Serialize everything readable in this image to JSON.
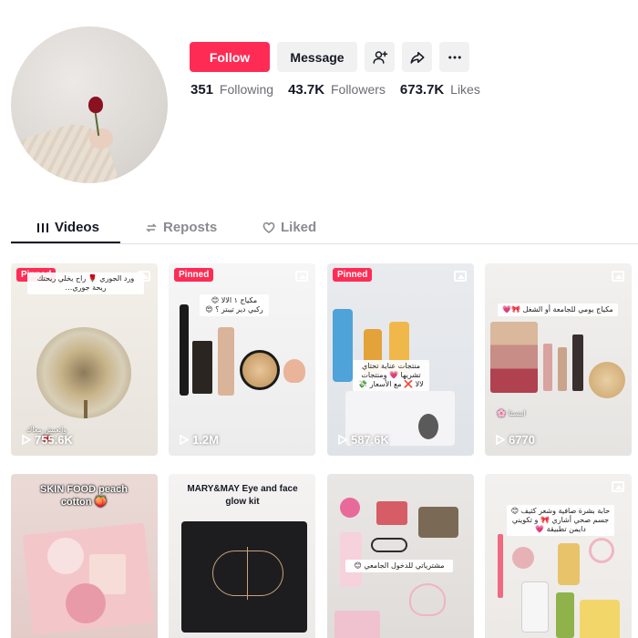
{
  "profile": {
    "follow_label": "Follow",
    "message_label": "Message",
    "stats": {
      "following_count": "351",
      "following_label": "Following",
      "followers_count": "43.7K",
      "followers_label": "Followers",
      "likes_count": "673.7K",
      "likes_label": "Likes"
    }
  },
  "tabs": [
    {
      "label": "Videos",
      "active": true
    },
    {
      "label": "Reposts",
      "active": false
    },
    {
      "label": "Liked",
      "active": false
    }
  ],
  "colors": {
    "accent": "#fe2c55",
    "text": "#161823",
    "muted": "#8a8b91"
  },
  "videos": [
    {
      "pinned": "Pinned",
      "views": "755.6K",
      "caption": "ورد الجوري 🌹 راح يخلي ريحتك ريحة جوري…",
      "bottom_caption": "وانعيش معاك 🎀"
    },
    {
      "pinned": "Pinned",
      "views": "1.2M",
      "caption": "مكياج ١ الالا 😊 ركبي دير تيبتر ؟ 😍"
    },
    {
      "pinned": "Pinned",
      "views": "587.6K",
      "caption": "منتجات عناية تحتاي تشريها 💗 ومنتجات لالا ❌ مع الأسعار 💸"
    },
    {
      "pinned": "",
      "views": "6770",
      "caption": "مكياج يومي للجامعة أو الشغل 🎀💗",
      "bottom_caption": "ابنستا 🌸"
    },
    {
      "title": "SKIN FOOD peach cotton 🍑"
    },
    {
      "title": "MARY&MAY Eye and face glow kit"
    },
    {
      "caption": "مشترياتي للدخول الجامعي 😊"
    },
    {
      "caption": "حابة بشرة صافية وشعر كثيف 😊 جسم صحي أشاري 🎀 و تكويني دايمن تطبيقة 💗"
    }
  ]
}
